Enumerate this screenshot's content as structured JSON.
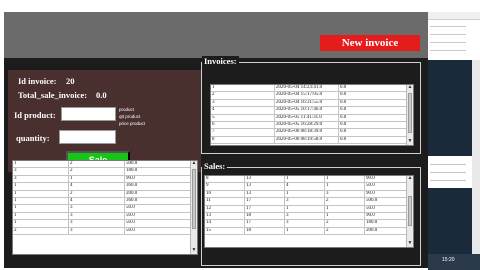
{
  "header": {
    "new_invoice_label": "New invoice"
  },
  "form": {
    "id_invoice_label": "Id invoice:",
    "id_invoice_value": "20",
    "total_label": "Total_sale_invoice:",
    "total_value": "0.0",
    "id_product_label": "Id product:",
    "id_product_value": "",
    "quantity_label": "quantity:",
    "quantity_value": "",
    "hints": [
      "product",
      "qtt product",
      "price product"
    ],
    "sale_label": "Sale"
  },
  "product_table": {
    "rows": [
      [
        "1",
        "2",
        "500.0"
      ],
      [
        "3",
        "2",
        "180.0"
      ],
      [
        "3",
        "1",
        "90.0"
      ],
      [
        "1",
        "4",
        "360.0"
      ],
      [
        "1",
        "2",
        "200.0"
      ],
      [
        "1",
        "4",
        "360.0"
      ],
      [
        "1",
        "3",
        "50.0"
      ],
      [
        "1",
        "3",
        "50.0"
      ],
      [
        "1",
        "3",
        "50.0"
      ],
      [
        "2",
        "3",
        "50.0"
      ]
    ]
  },
  "invoices": {
    "label": "Invoices:",
    "rows": [
      [
        "1",
        "2020-05-04 14:23:41.0",
        "0.0"
      ],
      [
        "2",
        "2020-05-04 15:17:05.0",
        "0.0"
      ],
      [
        "3",
        "2020-05-04 16:31:55.0",
        "0.0"
      ],
      [
        "4",
        "2020-05-05 10:17:46.0",
        "0.0"
      ],
      [
        "5",
        "2020-05-05 11:41:31.0",
        "0.0"
      ],
      [
        "6",
        "2020-05-05 16:28:29.0",
        "0.0"
      ],
      [
        "7",
        "2020-05-06 08:18:39.0",
        "0.0"
      ],
      [
        "8",
        "2020-05-06 08:19:58.0",
        "0.0"
      ]
    ]
  },
  "sales": {
    "label": "Sales:",
    "rows": [
      [
        "8",
        "13",
        "1",
        "1",
        "90.0"
      ],
      [
        "9",
        "13",
        "4",
        "1",
        "50.0"
      ],
      [
        "10",
        "13",
        "1",
        "3",
        "90.0"
      ],
      [
        "11",
        "17",
        "3",
        "2",
        "500.0"
      ],
      [
        "12",
        "17",
        "1",
        "1",
        "50.0"
      ],
      [
        "13",
        "18",
        "3",
        "1",
        "90.0"
      ],
      [
        "14",
        "17",
        "3",
        "2",
        "180.0"
      ],
      [
        "15",
        "18",
        "1",
        "2",
        "200.0"
      ]
    ]
  },
  "system": {
    "time": "15:20"
  }
}
